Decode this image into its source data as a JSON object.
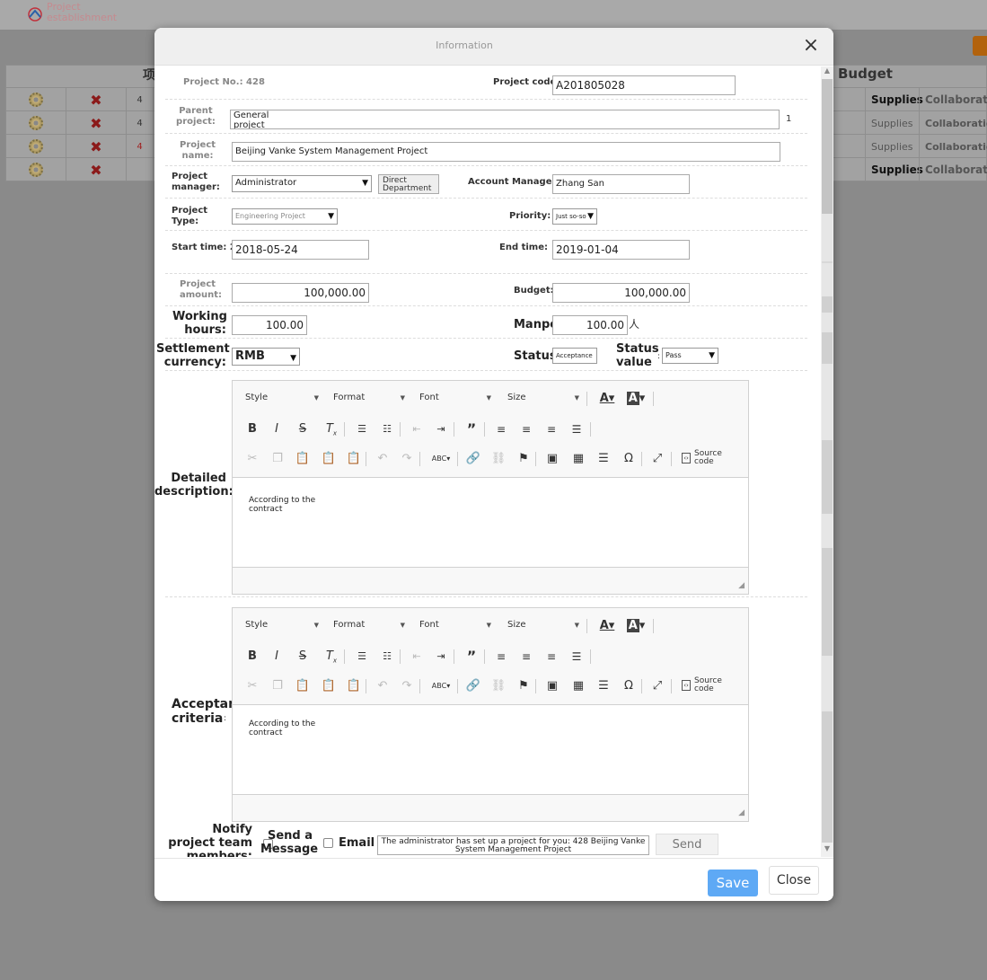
{
  "background": {
    "app_title": "Project establishment",
    "header_budget": "Budget",
    "header_col_fragment": "项",
    "rows": [
      {
        "num": "4",
        "c1": "Supplies",
        "c2": "Collaboratio",
        "bold": true,
        "red": false
      },
      {
        "num": "4",
        "c1": "Supplies",
        "c2": "Collaboration",
        "bold": false,
        "red": false
      },
      {
        "num": "4",
        "c1": "Supplies",
        "c2": "Collaboration",
        "bold": false,
        "red": true
      },
      {
        "num": "",
        "c1": "Supplies",
        "c2": "Collaboration",
        "bold": true,
        "red": false
      }
    ]
  },
  "modal": {
    "title": "Information",
    "close_glyph": "×",
    "save_label": "Save",
    "close_label": "Close"
  },
  "form": {
    "project_no_label": "Project No.: 428",
    "project_code_label": "Project code:",
    "project_code_value": "A201805028",
    "parent_project_label": "Parent project:",
    "parent_project_value": "General project",
    "parent_project_suffix": "1",
    "project_name_label": "Project name:",
    "project_name_value": "Beijing Vanke System Management Project",
    "project_manager_label": "Project manager:",
    "project_manager_value": "Administrator",
    "direct_department_label": "Direct Department",
    "account_manager_label": "Account Manager:",
    "account_manager_value": "Zhang San",
    "project_type_label": "Project Type:",
    "project_type_value": "Engineering Project",
    "priority_label": "Priority:",
    "priority_value": "Just so-so",
    "start_time_label": "Start time: 2018-05-24",
    "start_time_value": "2018-05-24",
    "end_time_label": "End time:",
    "end_time_value": "2019-01-04",
    "project_amount_label": "Project amount:",
    "project_amount_value": "100,000.00",
    "budget_label": "Budget:",
    "budget_value": "100,000.00",
    "working_hours_label": "Working hours:",
    "working_hours_value": "100.00",
    "manpower_label": "Manpower:",
    "manpower_value": "100.00",
    "manpower_unit": "人",
    "settlement_currency_label": "Settlement currency:",
    "settlement_currency_value": "RMB",
    "status_label": "Status",
    "status_value_box": "Acceptance",
    "status_value_label": "Status value",
    "status_value_colon": ":",
    "status_value_select": "Pass",
    "detailed_description_label": "Detailed description:",
    "acceptance_criteria_label": "Acceptance criteria",
    "acceptance_criteria_colon": ":",
    "editor_text": "According to the contract",
    "notify_label": "Notify project team members:",
    "send_message_label": "Send a Message",
    "email_label": "Email",
    "message_text": "The administrator has set up a project for you: 428 Beijing Vanke System Management Project",
    "send_label": "Send"
  },
  "editor_toolbar": {
    "style": "Style",
    "format": "Format",
    "font": "Font",
    "size": "Size",
    "source_code": "Source code",
    "icons": [
      "text-color-icon",
      "bg-color-icon",
      "bold-icon",
      "italic-icon",
      "strike-icon",
      "remove-format-icon",
      "numbered-list-icon",
      "bulleted-list-icon",
      "outdent-icon",
      "indent-icon",
      "blockquote-icon",
      "align-left-icon",
      "align-center-icon",
      "align-right-icon",
      "justify-icon",
      "cut-icon",
      "copy-icon",
      "paste-icon",
      "paste-text-icon",
      "paste-word-icon",
      "undo-icon",
      "redo-icon",
      "spellcheck-icon",
      "link-icon",
      "unlink-icon",
      "anchor-icon",
      "image-icon",
      "table-icon",
      "hr-icon",
      "special-char-icon",
      "maximize-icon",
      "source-icon"
    ]
  }
}
